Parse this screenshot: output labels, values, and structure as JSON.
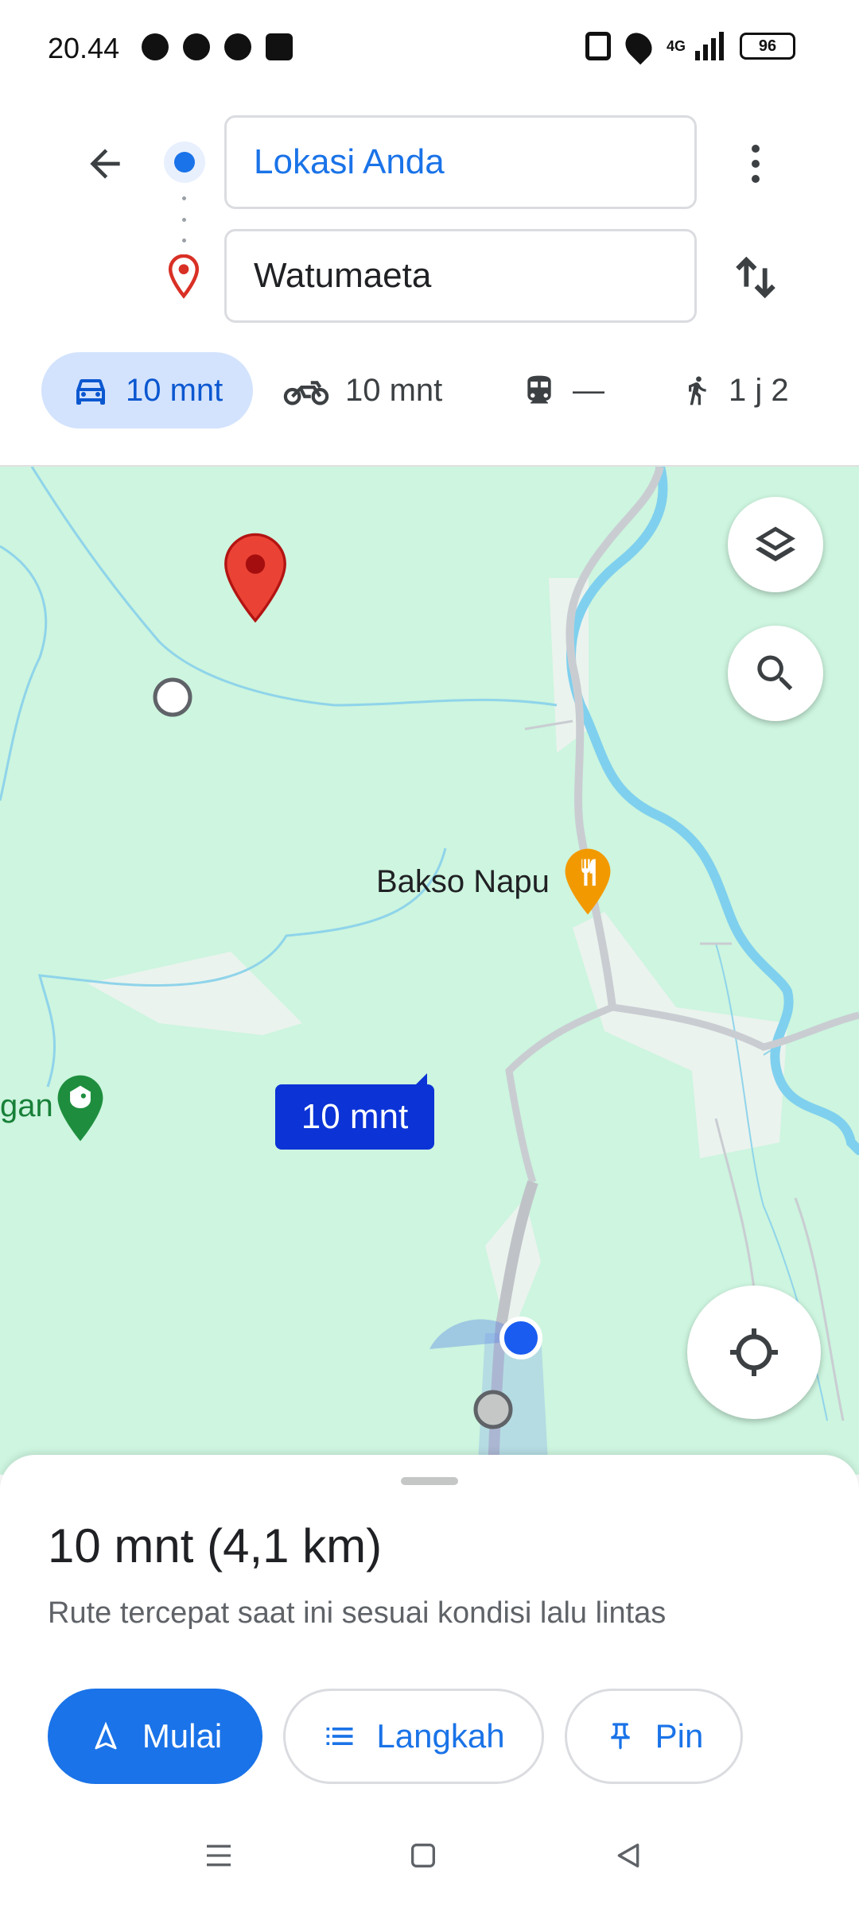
{
  "status_bar": {
    "time": "20.44",
    "network": "4G",
    "battery": "96",
    "icons": [
      "bubble-icon",
      "whatsapp-icon",
      "line-icon",
      "money-icon",
      "nfc-icon",
      "location-icon",
      "signal-icon",
      "battery-icon"
    ]
  },
  "directions": {
    "origin": "Lokasi Anda",
    "destination": "Watumaeta"
  },
  "modes": {
    "car": "10 mnt",
    "motorcycle": "10 mnt",
    "transit": "—",
    "walk": "1 j 2"
  },
  "map": {
    "poi_restaurant": "Bakso Napu",
    "poi_partial": "gan",
    "route_time_chip": "10 mnt"
  },
  "route": {
    "summary": "10 mnt (4,1 km)",
    "description": "Rute tercepat saat ini sesuai kondisi lalu lintas"
  },
  "actions": {
    "start": "Mulai",
    "steps": "Langkah",
    "pin": "Pin"
  },
  "colors": {
    "accent": "#1a73e8",
    "map_green": "#cdf5df",
    "river": "#7fd0ee",
    "route_chip": "#0b33d6",
    "restaurant_pin": "#f29900",
    "destination_pin": "#ea4335"
  }
}
